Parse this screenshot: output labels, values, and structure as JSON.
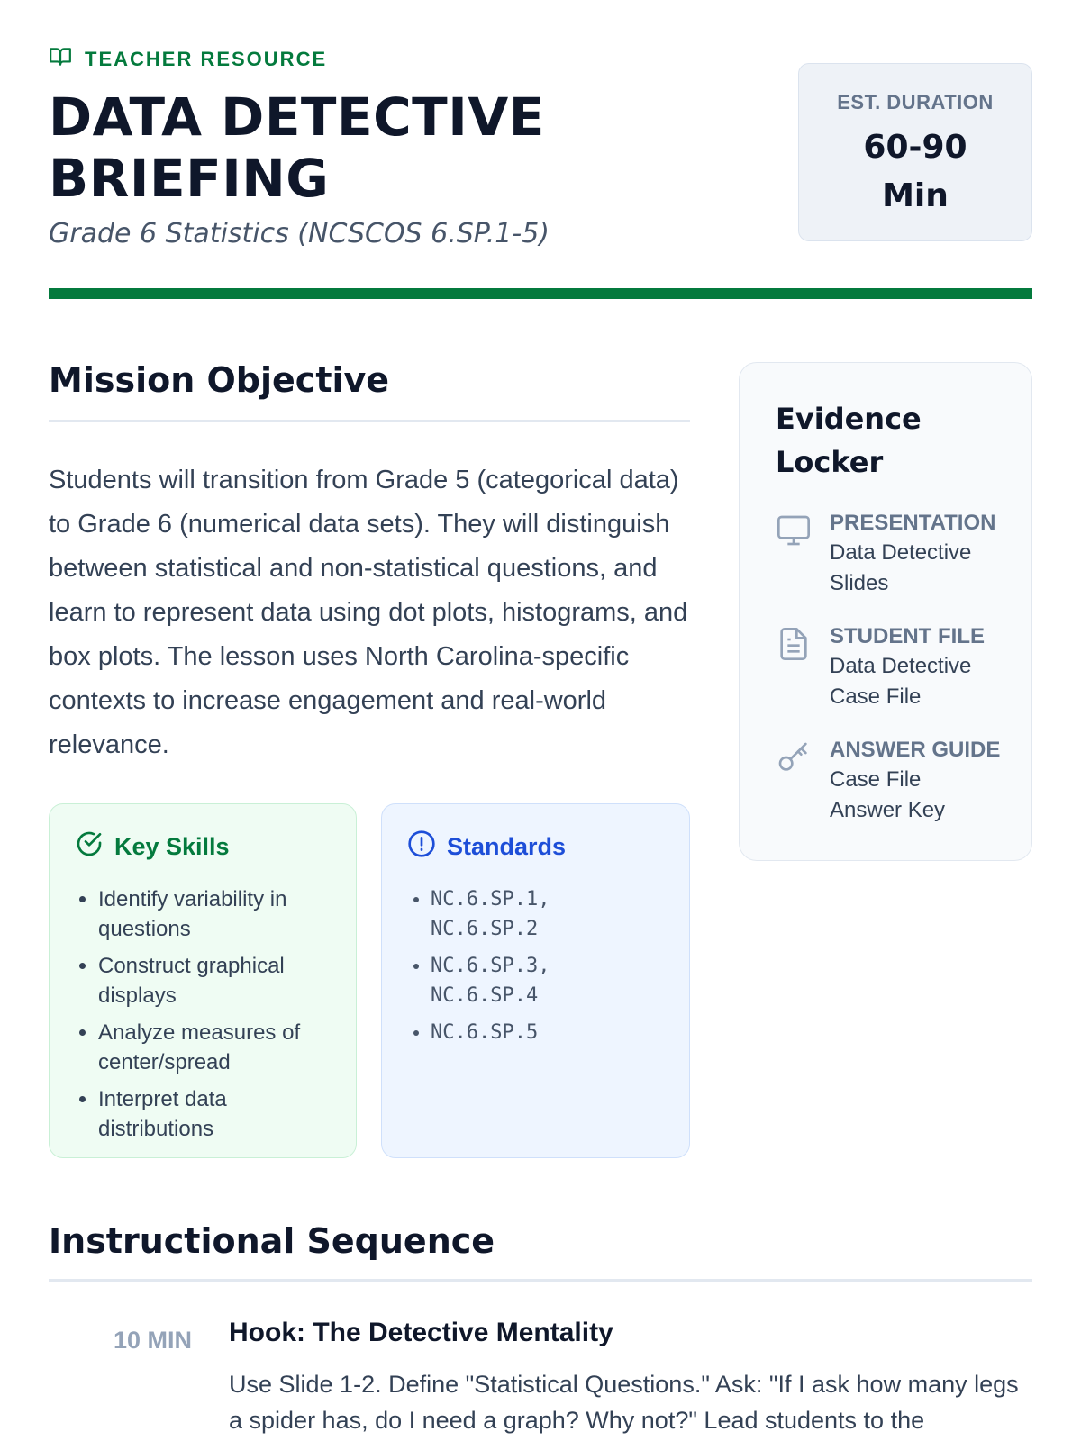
{
  "header": {
    "kicker": "TEACHER RESOURCE",
    "title": "DATA DETECTIVE BRIEFING",
    "subtitle": "Grade 6 Statistics (NCSCOS 6.SP.1-5)",
    "duration_label": "EST. DURATION",
    "duration_value": "60-90 Min"
  },
  "mission": {
    "heading": "Mission Objective",
    "text": "Students will transition from Grade 5 (categorical data) to Grade 6 (numerical data sets). They will distinguish between statistical and non-statistical questions, and learn to represent data using dot plots, histograms, and box plots. The lesson uses North Carolina-specific contexts to increase engagement and real-world relevance."
  },
  "key_skills": {
    "heading": "Key Skills",
    "items": [
      "Identify variability in questions",
      "Construct graphical displays",
      "Analyze measures of center/spread",
      "Interpret data distributions"
    ]
  },
  "standards": {
    "heading": "Standards",
    "items": [
      "NC.6.SP.1, NC.6.SP.2",
      "NC.6.SP.3, NC.6.SP.4",
      "NC.6.SP.5"
    ]
  },
  "evidence_locker": {
    "heading": "Evidence Locker",
    "items": [
      {
        "type": "PRESENTATION",
        "name": "Data Detective Slides",
        "icon": "monitor-icon"
      },
      {
        "type": "STUDENT FILE",
        "name": "Data Detective Case File",
        "icon": "document-icon"
      },
      {
        "type": "ANSWER GUIDE",
        "name": "Case File Answer Key",
        "icon": "key-icon"
      }
    ]
  },
  "sequence": {
    "heading": "Instructional Sequence",
    "steps": [
      {
        "duration": "10 MIN",
        "title": "Hook: The Detective Mentality",
        "description": "Use Slide 1-2. Define \"Statistical Questions.\" Ask: \"If I ask how many legs a spider has, do I need a graph? Why not?\" Lead students to the"
      }
    ]
  },
  "colors": {
    "brand_green": "#047a3d",
    "standards_blue": "#1d4ed8"
  }
}
